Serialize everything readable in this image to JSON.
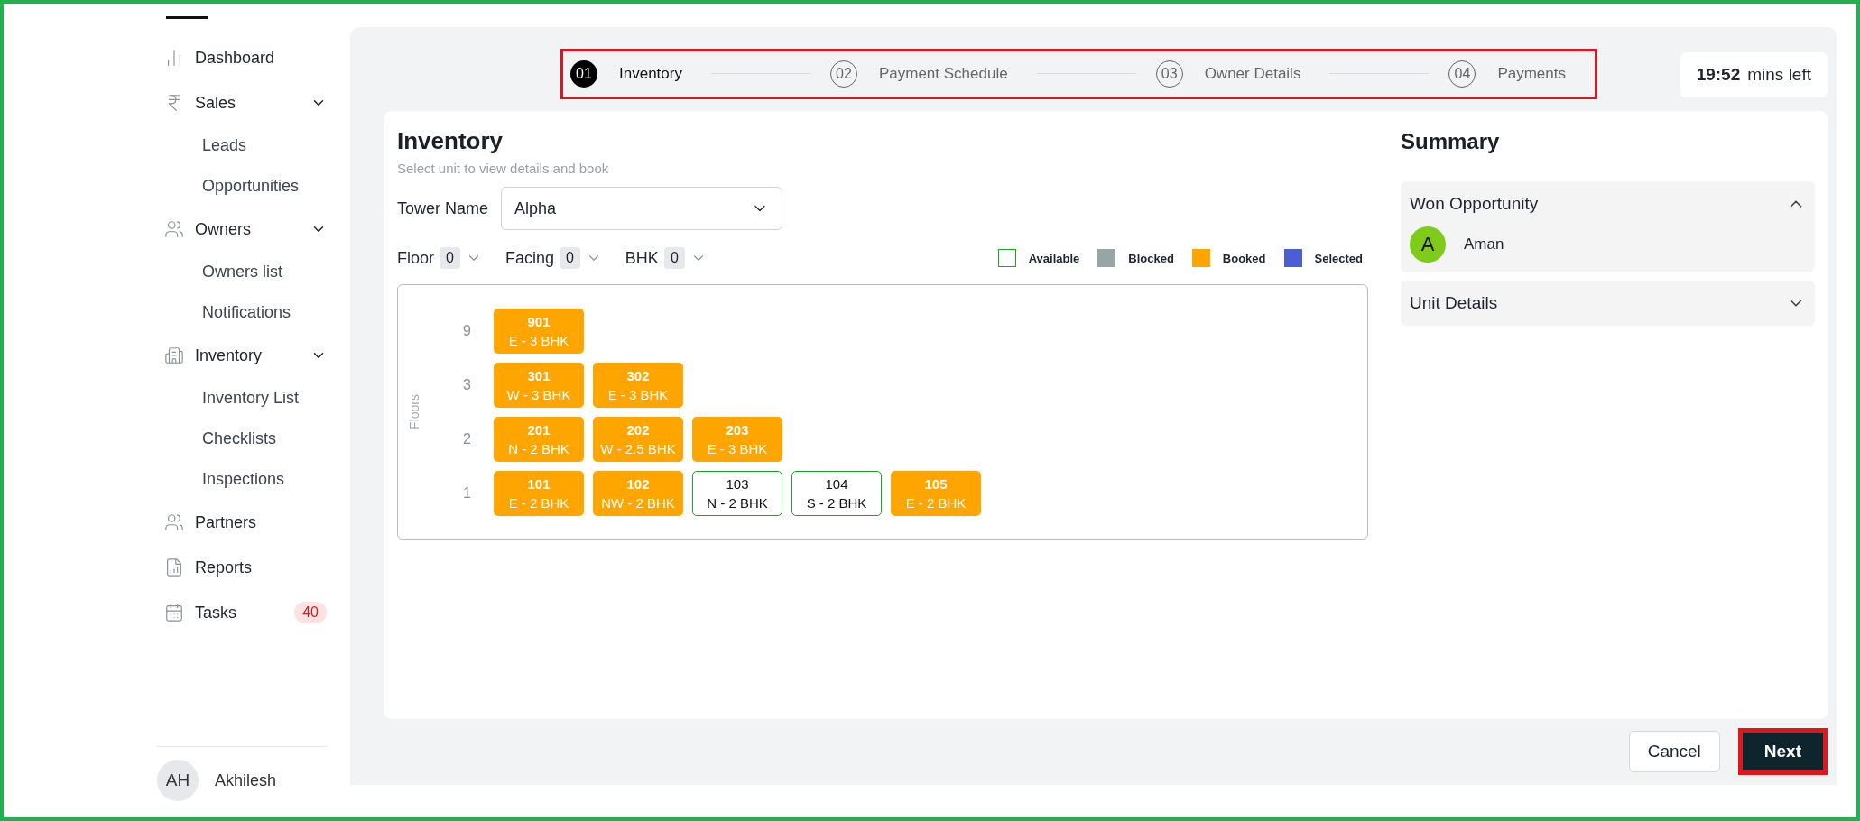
{
  "sidebar": {
    "items": [
      {
        "label": "Dashboard"
      },
      {
        "label": "Sales",
        "children": [
          {
            "label": "Leads"
          },
          {
            "label": "Opportunities"
          }
        ]
      },
      {
        "label": "Owners",
        "children": [
          {
            "label": "Owners list"
          },
          {
            "label": "Notifications"
          }
        ]
      },
      {
        "label": "Inventory",
        "children": [
          {
            "label": "Inventory List"
          },
          {
            "label": "Checklists"
          },
          {
            "label": "Inspections"
          }
        ]
      },
      {
        "label": "Partners"
      },
      {
        "label": "Reports"
      },
      {
        "label": "Tasks",
        "badge": "40"
      }
    ],
    "user": {
      "initials": "AH",
      "name": "Akhilesh"
    }
  },
  "stepper": {
    "steps": [
      {
        "number": "01",
        "label": "Inventory",
        "selected": true
      },
      {
        "number": "02",
        "label": "Payment Schedule",
        "selected": false
      },
      {
        "number": "03",
        "label": "Owner Details",
        "selected": false
      },
      {
        "number": "04",
        "label": "Payments",
        "selected": false
      }
    ]
  },
  "timer": {
    "time": "19:52",
    "suffix": "mins left"
  },
  "inventory": {
    "title": "Inventory",
    "subtitle": "Select unit to view details and book",
    "tower": {
      "label": "Tower Name",
      "value": "Alpha"
    },
    "filters": [
      {
        "label": "Floor",
        "count": "0"
      },
      {
        "label": "Facing",
        "count": "0"
      },
      {
        "label": "BHK",
        "count": "0"
      }
    ],
    "legend": [
      {
        "label": "Available",
        "kind": "available"
      },
      {
        "label": "Blocked",
        "kind": "blocked"
      },
      {
        "label": "Booked",
        "kind": "booked"
      },
      {
        "label": "Selected",
        "kind": "selected"
      }
    ],
    "axis_label": "Floors",
    "floors": [
      {
        "floor": "9",
        "units": [
          {
            "number": "901",
            "detail": "E - 3 BHK",
            "kind": "booked"
          }
        ]
      },
      {
        "floor": "3",
        "units": [
          {
            "number": "301",
            "detail": "W - 3 BHK",
            "kind": "booked"
          },
          {
            "number": "302",
            "detail": "E - 3 BHK",
            "kind": "booked"
          }
        ]
      },
      {
        "floor": "2",
        "units": [
          {
            "number": "201",
            "detail": "N - 2 BHK",
            "kind": "booked"
          },
          {
            "number": "202",
            "detail": "W - 2.5 BHK",
            "kind": "booked"
          },
          {
            "number": "203",
            "detail": "E - 3 BHK",
            "kind": "booked"
          }
        ]
      },
      {
        "floor": "1",
        "units": [
          {
            "number": "101",
            "detail": "E - 2 BHK",
            "kind": "booked"
          },
          {
            "number": "102",
            "detail": "NW - 2 BHK",
            "kind": "booked"
          },
          {
            "number": "103",
            "detail": "N - 2 BHK",
            "kind": "available"
          },
          {
            "number": "104",
            "detail": "S - 2 BHK",
            "kind": "available"
          },
          {
            "number": "105",
            "detail": "E - 2 BHK",
            "kind": "booked"
          }
        ]
      }
    ]
  },
  "summary": {
    "title": "Summary",
    "sections": [
      {
        "title": "Won Opportunity",
        "expanded": true,
        "contact": {
          "initial": "A",
          "name": "Aman"
        }
      },
      {
        "title": "Unit Details",
        "expanded": false
      }
    ]
  },
  "buttons": [
    {
      "label": "Cancel",
      "kind": "secondary"
    },
    {
      "label": "Next",
      "kind": "primary"
    }
  ]
}
